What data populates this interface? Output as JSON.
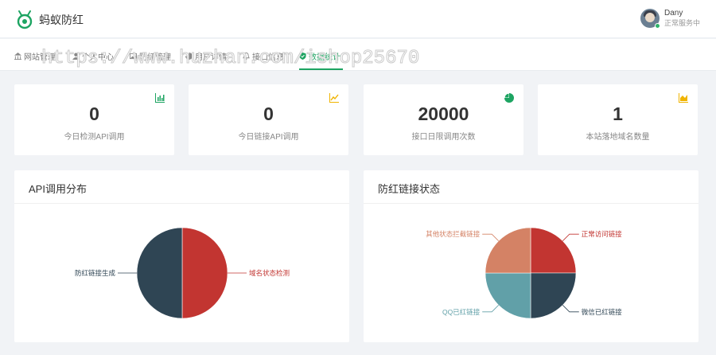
{
  "app": {
    "brand": "蚂蚁防红"
  },
  "user": {
    "name": "Dany",
    "status": "正常服务中"
  },
  "nav": [
    {
      "label": "网站管理",
      "icon": "bank-icon"
    },
    {
      "label": "个人中心",
      "icon": "user-icon"
    },
    {
      "label": "防红管理",
      "icon": "image-icon"
    },
    {
      "label": "用户详情",
      "icon": "pie-icon"
    },
    {
      "label": "接口信息",
      "icon": "bell-icon"
    },
    {
      "label": "数据统计",
      "icon": "shield-check-icon"
    }
  ],
  "watermark": "https://www.huzhan.com/ishop25670",
  "stats": [
    {
      "value": "0",
      "label": "今日检测API调用",
      "icon": "bar-chart-icon",
      "color": "#1da462"
    },
    {
      "value": "0",
      "label": "今日链接API调用",
      "icon": "line-chart-icon",
      "color": "#f0b400"
    },
    {
      "value": "20000",
      "label": "接口日限调用次数",
      "icon": "pie-chart-icon",
      "color": "#1da462"
    },
    {
      "value": "1",
      "label": "本站落地域名数量",
      "icon": "area-chart-icon",
      "color": "#f0b400"
    }
  ],
  "panels": {
    "api": {
      "title": "API调用分布"
    },
    "link": {
      "title": "防红链接状态"
    }
  },
  "chart_data": [
    {
      "type": "pie",
      "title": "API调用分布",
      "categories": [
        "域名状态检测",
        "防红链接生成"
      ],
      "values": [
        50,
        50
      ],
      "colors": [
        "#c23531",
        "#2f4554"
      ]
    },
    {
      "type": "pie",
      "title": "防红链接状态",
      "categories": [
        "正常访问链接",
        "微信已红链接",
        "QQ已红链接",
        "其他状态拦截链接"
      ],
      "values": [
        25,
        25,
        25,
        25
      ],
      "colors": [
        "#c23531",
        "#2f4554",
        "#61a0a8",
        "#d48265"
      ]
    }
  ],
  "colors": {
    "accent": "#1da462"
  }
}
